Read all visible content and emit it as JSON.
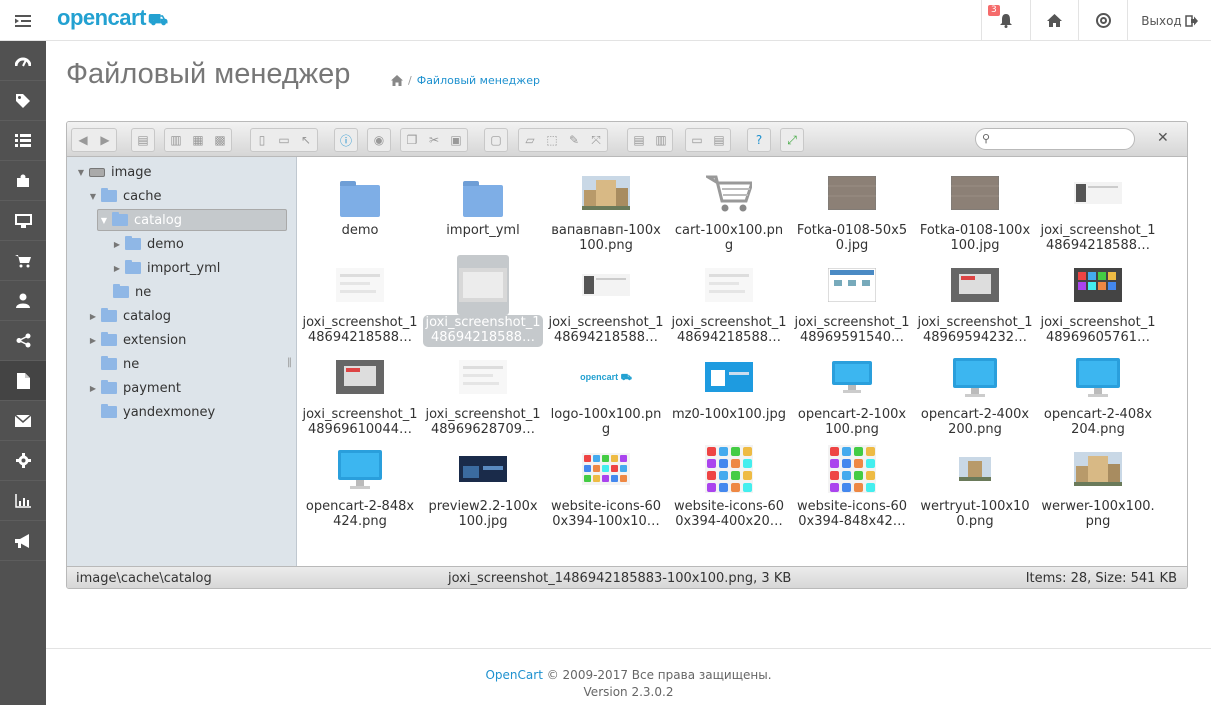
{
  "header": {
    "logo": "opencart",
    "notifications_count": "3",
    "logout_label": "Выход"
  },
  "sidebar": {
    "items": [
      "dashboard-icon",
      "tag-icon",
      "list-icon",
      "puzzle-icon",
      "desktop-icon",
      "cart-icon",
      "user-icon",
      "share-icon",
      "file-icon",
      "envelope-icon",
      "cog-icon",
      "chart-icon",
      "bullhorn-icon"
    ],
    "active": "file-icon"
  },
  "page": {
    "title": "Файловый менеджер",
    "breadcrumb": "Файловый менеджер"
  },
  "tree": [
    {
      "label": "image",
      "depth": 0,
      "expanded": true,
      "type": "drive"
    },
    {
      "label": "cache",
      "depth": 1,
      "expanded": true
    },
    {
      "label": "catalog",
      "depth": 2,
      "expanded": true,
      "selected": true
    },
    {
      "label": "demo",
      "depth": 3,
      "expanded": false
    },
    {
      "label": "import_yml",
      "depth": 3,
      "expanded": false
    },
    {
      "label": "ne",
      "depth": 2,
      "leaf": true
    },
    {
      "label": "catalog",
      "depth": 1,
      "expanded": false
    },
    {
      "label": "extension",
      "depth": 1,
      "expanded": false
    },
    {
      "label": "ne",
      "depth": 1,
      "leaf": true
    },
    {
      "label": "payment",
      "depth": 1,
      "expanded": false
    },
    {
      "label": "yandexmoney",
      "depth": 1,
      "leaf": true
    }
  ],
  "files": [
    {
      "name": "demo",
      "kind": "folder"
    },
    {
      "name": "import_yml",
      "kind": "folder"
    },
    {
      "name": "вапавпавп-100x100.png",
      "kind": "building"
    },
    {
      "name": "cart-100x100.png",
      "kind": "cart"
    },
    {
      "name": "Fotka-0108-50x50.jpg",
      "kind": "photo"
    },
    {
      "name": "Fotka-0108-100x100.jpg",
      "kind": "photo"
    },
    {
      "name": "joxi_screenshot_148694218588…",
      "kind": "screen-dark"
    },
    {
      "name": "joxi_screenshot_148694218588…",
      "kind": "screen-light"
    },
    {
      "name": "joxi_screenshot_148694218588…",
      "kind": "selected",
      "selected": true
    },
    {
      "name": "joxi_screenshot_148694218588…",
      "kind": "screen-dark"
    },
    {
      "name": "joxi_screenshot_148694218588…",
      "kind": "screen-light"
    },
    {
      "name": "joxi_screenshot_148969591540…",
      "kind": "screen-blue"
    },
    {
      "name": "joxi_screenshot_148969594232…",
      "kind": "screen-grey"
    },
    {
      "name": "joxi_screenshot_148969605761…",
      "kind": "screen-tiles"
    },
    {
      "name": "joxi_screenshot_148969610044…",
      "kind": "screen-grey"
    },
    {
      "name": "joxi_screenshot_148969628709…",
      "kind": "screen-light"
    },
    {
      "name": "logo-100x100.png",
      "kind": "logo"
    },
    {
      "name": "mz0-100x100.jpg",
      "kind": "mz0"
    },
    {
      "name": "opencart-2-100x100.png",
      "kind": "monitor-small"
    },
    {
      "name": "opencart-2-400x200.png",
      "kind": "monitor"
    },
    {
      "name": "opencart-2-408x204.png",
      "kind": "monitor"
    },
    {
      "name": "opencart-2-848x424.png",
      "kind": "monitor"
    },
    {
      "name": "preview2.2-100x100.jpg",
      "kind": "preview"
    },
    {
      "name": "website-icons-600x394-100x10…",
      "kind": "icons-small"
    },
    {
      "name": "website-icons-600x394-400x20…",
      "kind": "icons"
    },
    {
      "name": "website-icons-600x394-848x42…",
      "kind": "icons"
    },
    {
      "name": "wertryut-100x100.png",
      "kind": "building-small"
    },
    {
      "name": "werwer-100x100.png",
      "kind": "building"
    }
  ],
  "status": {
    "path": "image\\cache\\catalog",
    "file": "joxi_screenshot_1486942185883-100x100.png, 3 KB",
    "count": "Items: 28, Size: 541 KB"
  },
  "footer": {
    "link": "OpenCart",
    "rights": "© 2009-2017 Все права защищены.",
    "version": "Version 2.3.0.2"
  }
}
